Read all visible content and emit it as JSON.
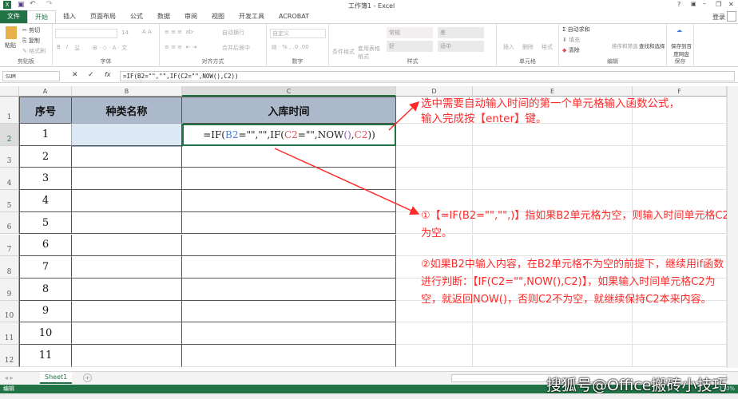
{
  "window": {
    "title": "工作簿1 - Excel",
    "help": "?",
    "minimize": "–",
    "restore": "❐",
    "close": "✕",
    "login": "登录"
  },
  "tabs": [
    "文件",
    "开始",
    "插入",
    "页面布局",
    "公式",
    "数据",
    "审阅",
    "视图",
    "开发工具",
    "ACROBAT"
  ],
  "ribbon": {
    "clipboard": {
      "label": "剪贴板",
      "paste": "粘贴",
      "cut": "剪切",
      "copy": "复制",
      "format_painter": "格式刷"
    },
    "font": {
      "label": "字体",
      "size": "14",
      "bold": "B",
      "italic": "I",
      "underline": "U"
    },
    "alignment": {
      "label": "对齐方式",
      "wrap": "自动换行",
      "merge": "合并后居中"
    },
    "number": {
      "label": "数字",
      "format": "自定义"
    },
    "styles": {
      "label": "样式",
      "conditional": "条件格式",
      "table": "套用表格格式",
      "cells": [
        "常规",
        "差",
        "好",
        "适中"
      ]
    },
    "cells": {
      "label": "单元格",
      "insert": "插入",
      "delete": "删除",
      "format": "格式"
    },
    "editing": {
      "label": "编辑",
      "autosum": "自动求和",
      "fill": "填充",
      "clear": "清除",
      "sort": "排序和筛选",
      "find": "查找和选择"
    },
    "save": {
      "label": "保存",
      "baidu": "保存到百度网盘"
    }
  },
  "formula_bar": {
    "name_box": "SUM",
    "cancel": "✕",
    "enter": "✓",
    "fx": "fx",
    "formula": "=IF(B2=\"\",\"\",IF(C2=\"\",NOW(),C2))"
  },
  "columns": [
    "A",
    "B",
    "C",
    "D",
    "E",
    "F"
  ],
  "rows": [
    "1",
    "2",
    "3",
    "4",
    "5",
    "6",
    "7",
    "8",
    "9",
    "10",
    "11",
    "12"
  ],
  "table": {
    "headers": [
      "序号",
      "种类名称",
      "入库时间"
    ],
    "serials": [
      "1",
      "2",
      "3",
      "4",
      "5",
      "6",
      "7",
      "8",
      "9",
      "10",
      "11"
    ],
    "c2_parts": [
      "=IF(",
      "B2",
      "=\"\",\"\",IF(",
      "C2",
      "=\"\",NOW",
      "()",
      ",",
      "C2",
      "))"
    ]
  },
  "annotations": {
    "top": [
      "选中需要自动输入时间的第一个单元格输入函数公式，",
      "输入完成按【enter】键。"
    ],
    "note1": "①【=IF(B2=\"\",\"\",)】指如果B2单元格为空，则输入时间单元格C2为空。",
    "note2": "②如果B2中输入内容，在B2单元格不为空的前提下，继续用if函数进行判断：【IF(C2=\"\",NOW(),C2)】，如果输入时间单元格C2为空，就返回NOW()，否则C2不为空，就继续保持C2本来内容。"
  },
  "sheet_tabs": {
    "active": "Sheet1",
    "add": "+"
  },
  "status": {
    "mode": "编辑",
    "zoom": "130%"
  },
  "watermark": "搜狐号@Office搬砖小技巧",
  "colors": {
    "excel_green": "#217346",
    "header_fill": "#acb9ca",
    "note_red": "#ff2a2a",
    "ref_blue": "#4a7fd6",
    "ref_red": "#e0505a",
    "ref_purple": "#8a5ab0"
  }
}
